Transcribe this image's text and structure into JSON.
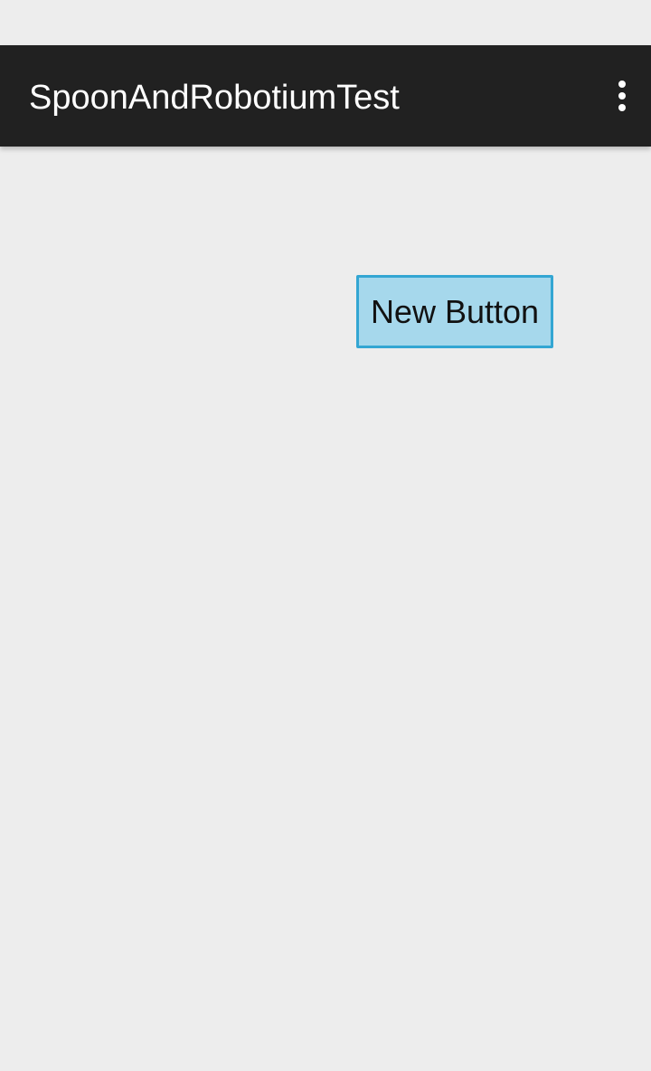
{
  "app": {
    "title": "SpoonAndRobotiumTest"
  },
  "action_bar": {
    "overflow_icon": "more-vert-icon"
  },
  "main": {
    "button_label": "New Button"
  },
  "colors": {
    "background": "#ededed",
    "action_bar": "#212121",
    "title_text": "#ffffff",
    "button_fill": "#a6d8ec",
    "button_border": "#33a6d3",
    "button_text": "#111111"
  }
}
